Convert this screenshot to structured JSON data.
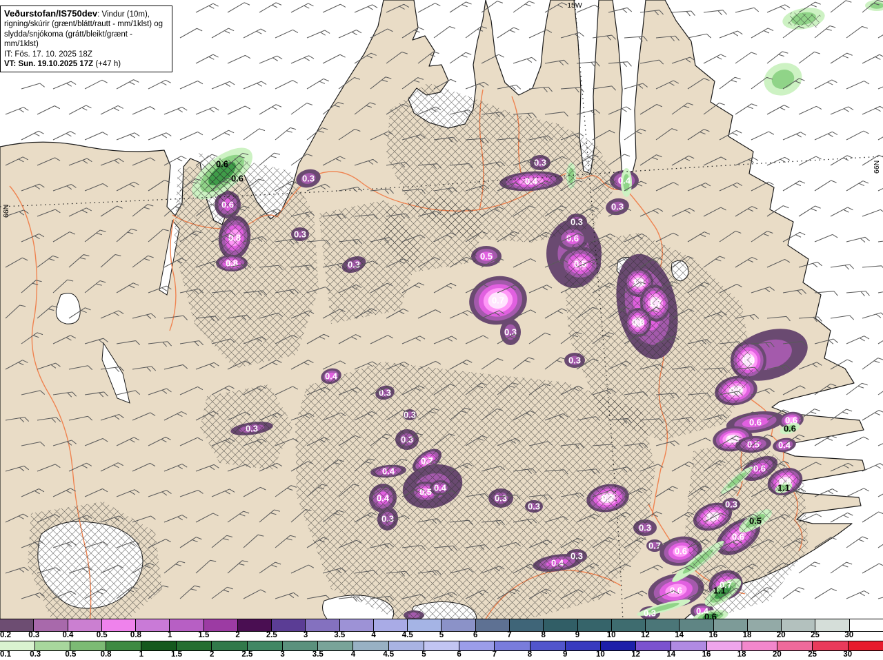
{
  "header": {
    "title_bold": "Veðurstofan/IS750dev",
    "title_rest": ": Vindur (10m),",
    "line2": "rigning/skúrir (grænt/blátt/rautt - mm/1klst) og",
    "line3": "slydda/snjókoma (grátt/bleikt/grænt - mm/1klst)",
    "line4": "IT: Fös. 17. 10. 2025 18Z",
    "line5_bold": "VT: Sun. 19.10.2025 17Z",
    "line5_rest": " (+47 h)"
  },
  "graticule": {
    "meridian_label": "15W",
    "parallel_label_left": "66N",
    "parallel_label_right": "66N"
  },
  "palette": {
    "ocean": "#ffffff",
    "land": "#e9dcc6",
    "coast": "#1a1a1a",
    "road": "#ef8350",
    "hatch": "#2b2b2b",
    "barb": "#5a5a5a",
    "purple_rings": [
      "#6a4a71",
      "#a45aac",
      "#e160e0",
      "#ff98f7",
      "#ffe4fe"
    ],
    "green_rings": [
      "#cdf2c3",
      "#90d488",
      "#3f9d49"
    ],
    "cell_label_purple": "#ffffff",
    "cell_label_green": "#000000"
  },
  "map": {
    "cells": [
      [
        447,
        259,
        36,
        26,
        -15,
        "0.3",
        1,
        "p"
      ],
      [
        330,
        297,
        38,
        40,
        0,
        "0.6",
        2,
        "p"
      ],
      [
        340,
        345,
        46,
        64,
        8,
        "0.8",
        3,
        "p"
      ],
      [
        336,
        382,
        46,
        24,
        0,
        "0.8",
        3,
        "p"
      ],
      [
        435,
        340,
        26,
        20,
        0,
        "0.3",
        1,
        "p"
      ],
      [
        513,
        384,
        36,
        22,
        -20,
        "0.3",
        1,
        "p"
      ],
      [
        705,
        372,
        44,
        30,
        0,
        "0.5",
        2,
        "p"
      ],
      [
        722,
        436,
        84,
        70,
        -10,
        "0.7",
        4,
        "p"
      ],
      [
        740,
        482,
        30,
        38,
        0,
        "0.3",
        1,
        "p"
      ],
      [
        836,
        322,
        30,
        24,
        0,
        "0.3",
        1,
        "p"
      ],
      [
        832,
        368,
        80,
        100,
        0,
        null,
        1,
        "p"
      ],
      [
        830,
        346,
        46,
        36,
        0,
        "0.6",
        2,
        "p"
      ],
      [
        841,
        383,
        60,
        50,
        0,
        "0.5",
        3,
        "p"
      ],
      [
        783,
        236,
        30,
        22,
        0,
        "0.3",
        1,
        "p"
      ],
      [
        770,
        263,
        92,
        28,
        -4,
        "0.4",
        3,
        "p"
      ],
      [
        905,
        262,
        42,
        30,
        0,
        "0.4",
        2,
        "p"
      ],
      [
        895,
        300,
        34,
        24,
        -10,
        "0.3",
        1,
        "p"
      ],
      [
        938,
        445,
        85,
        155,
        -12,
        null,
        2,
        "p"
      ],
      [
        926,
        410,
        42,
        42,
        0,
        "1.1",
        4,
        "p"
      ],
      [
        950,
        440,
        44,
        54,
        -10,
        "1.7",
        5,
        "p"
      ],
      [
        925,
        468,
        38,
        42,
        0,
        "0.8",
        4,
        "p"
      ],
      [
        833,
        523,
        30,
        22,
        0,
        "0.3",
        1,
        "p"
      ],
      [
        480,
        546,
        30,
        22,
        -15,
        "0.4",
        2,
        "p"
      ],
      [
        558,
        570,
        28,
        20,
        -15,
        "0.3",
        1,
        "p"
      ],
      [
        365,
        622,
        62,
        18,
        -8,
        "0.3",
        1,
        "p"
      ],
      [
        594,
        602,
        20,
        16,
        0,
        "0.3",
        1,
        "p"
      ],
      [
        590,
        638,
        34,
        30,
        0,
        "0.3",
        1,
        "p"
      ],
      [
        619,
        669,
        48,
        26,
        -35,
        "0.7",
        3,
        "p"
      ],
      [
        563,
        684,
        52,
        18,
        -5,
        "0.4",
        2,
        "p"
      ],
      [
        627,
        706,
        88,
        62,
        -15,
        null,
        1,
        "p"
      ],
      [
        617,
        714,
        42,
        30,
        0,
        "0.5",
        3,
        "p"
      ],
      [
        638,
        708,
        30,
        22,
        0,
        "0.4",
        2,
        "p"
      ],
      [
        555,
        723,
        40,
        42,
        15,
        "0.4",
        2,
        "p"
      ],
      [
        562,
        753,
        30,
        34,
        10,
        "0.3",
        1,
        "p"
      ],
      [
        726,
        723,
        36,
        28,
        0,
        "0.3",
        1,
        "p"
      ],
      [
        774,
        735,
        26,
        18,
        0,
        "0.3",
        1,
        "p"
      ],
      [
        881,
        723,
        62,
        40,
        -10,
        "0.7",
        4,
        "p"
      ],
      [
        935,
        766,
        34,
        24,
        0,
        "0.3",
        1,
        "p"
      ],
      [
        836,
        807,
        30,
        20,
        0,
        "0.3",
        1,
        "p"
      ],
      [
        808,
        817,
        72,
        24,
        -8,
        "0.4",
        2,
        "p"
      ],
      [
        1115,
        515,
        115,
        70,
        -18,
        null,
        1,
        "p"
      ],
      [
        1085,
        523,
        52,
        56,
        0,
        "0.8",
        4,
        "p"
      ],
      [
        1067,
        567,
        62,
        42,
        -10,
        "0.9",
        4,
        "p"
      ],
      [
        1095,
        613,
        85,
        30,
        -8,
        "0.6",
        2,
        "p"
      ],
      [
        1147,
        610,
        36,
        24,
        -10,
        "0.6",
        3,
        "p"
      ],
      [
        1062,
        637,
        58,
        36,
        -8,
        "1.1",
        4,
        "p"
      ],
      [
        1092,
        645,
        52,
        24,
        -5,
        "0.5",
        2,
        "p"
      ],
      [
        1137,
        646,
        34,
        20,
        -10,
        "0.4",
        2,
        "p"
      ],
      [
        1101,
        680,
        56,
        30,
        -25,
        "0.6",
        2,
        "p"
      ],
      [
        1138,
        699,
        52,
        38,
        -20,
        "0.8",
        4,
        "p"
      ],
      [
        1033,
        750,
        58,
        38,
        -20,
        "1.0",
        4,
        "p"
      ],
      [
        1070,
        779,
        72,
        42,
        -35,
        "0.6",
        3,
        "p"
      ],
      [
        987,
        800,
        62,
        42,
        -10,
        "0.6",
        3,
        "p"
      ],
      [
        949,
        792,
        24,
        18,
        0,
        "0.7",
        1,
        "p"
      ],
      [
        980,
        857,
        82,
        48,
        -10,
        "0.6",
        3,
        "p"
      ],
      [
        1052,
        849,
        50,
        42,
        -20,
        "0.7",
        3,
        "p"
      ],
      [
        942,
        890,
        30,
        20,
        0,
        "0.3",
        1,
        "p"
      ],
      [
        1018,
        887,
        34,
        22,
        0,
        "0.4",
        2,
        "p"
      ],
      [
        1060,
        732,
        26,
        18,
        0,
        "0.3",
        1,
        "p"
      ],
      [
        600,
        893,
        30,
        14,
        0,
        null,
        1,
        "p"
      ],
      [
        322,
        252,
        105,
        48,
        -38,
        null,
        2,
        "g"
      ],
      [
        322,
        238,
        0,
        0,
        0,
        "0.6",
        0,
        "g"
      ],
      [
        344,
        259,
        0,
        0,
        0,
        "0.6",
        0,
        "g"
      ],
      [
        1095,
        756,
        55,
        20,
        -32,
        "0.5",
        1,
        "g"
      ],
      [
        1048,
        860,
        62,
        24,
        -35,
        null,
        2,
        "g"
      ],
      [
        1043,
        857,
        0,
        0,
        0,
        "1.1",
        0,
        "g"
      ],
      [
        1030,
        895,
        52,
        18,
        -10,
        "0.6",
        2,
        "g"
      ],
      [
        1145,
        622,
        30,
        14,
        -20,
        "0.6",
        1,
        "g"
      ],
      [
        1136,
        708,
        26,
        14,
        -20,
        "1.1",
        1,
        "g"
      ],
      [
        1165,
        27,
        62,
        30,
        -10,
        null,
        1,
        "g"
      ],
      [
        1135,
        115,
        56,
        46,
        -20,
        null,
        1,
        "g"
      ],
      [
        1271,
        8,
        34,
        16,
        0,
        null,
        1,
        "g"
      ],
      [
        1012,
        815,
        95,
        16,
        -38,
        null,
        1,
        "g"
      ],
      [
        1068,
        697,
        60,
        12,
        -40,
        null,
        1,
        "g"
      ],
      [
        962,
        882,
        80,
        12,
        -15,
        null,
        1,
        "g"
      ],
      [
        828,
        255,
        14,
        38,
        0,
        null,
        1,
        "g"
      ],
      [
        908,
        265,
        16,
        42,
        0,
        null,
        1,
        "g"
      ]
    ]
  },
  "colorbars": {
    "sleet": {
      "labels": [
        "0.2",
        "0.3",
        "0.4",
        "0.5",
        "0.8",
        "1",
        "1.5",
        "2",
        "2.5",
        "3",
        "3.5",
        "4",
        "4.5",
        "5",
        "6",
        "7",
        "8",
        "9",
        "10",
        "12",
        "14",
        "16",
        "18",
        "20",
        "25",
        "30"
      ],
      "colors": [
        "#6d4d72",
        "#a869ab",
        "#cb7fd1",
        "#ef82ec",
        "#c97ad7",
        "#b75fc4",
        "#9c3ba3",
        "#4a0e52",
        "#5b3d95",
        "#8471bf",
        "#9d92d6",
        "#a9abe6",
        "#a5b4e5",
        "#8b92c8",
        "#5e7193",
        "#3f6578",
        "#315e66",
        "#36646a",
        "#3e6c6f",
        "#4b7678",
        "#5f8584",
        "#7d9b98",
        "#93aaa7",
        "#b3c1be",
        "#d5ded9",
        "#ffffff"
      ]
    },
    "rain": {
      "labels": [
        "0.1",
        "0.3",
        "0.5",
        "0.8",
        "1",
        "1.5",
        "2",
        "2.5",
        "3",
        "3.5",
        "4",
        "4.5",
        "5",
        "6",
        "7",
        "8",
        "9",
        "10",
        "12",
        "14",
        "16",
        "18",
        "20",
        "25",
        "30"
      ],
      "colors": [
        "#daf2d0",
        "#a8d79d",
        "#7cbb74",
        "#3e8a42",
        "#15591d",
        "#256e30",
        "#31794a",
        "#418764",
        "#5b917d",
        "#79a499",
        "#98b1c4",
        "#a9b3e3",
        "#c2c5f2",
        "#9b9de9",
        "#797cdc",
        "#5155cc",
        "#383bbf",
        "#1d1fa9",
        "#7b52cf",
        "#b08ae3",
        "#efa5ec",
        "#f287cc",
        "#ef6a9b",
        "#e93b5b",
        "#e71b2d"
      ]
    }
  }
}
